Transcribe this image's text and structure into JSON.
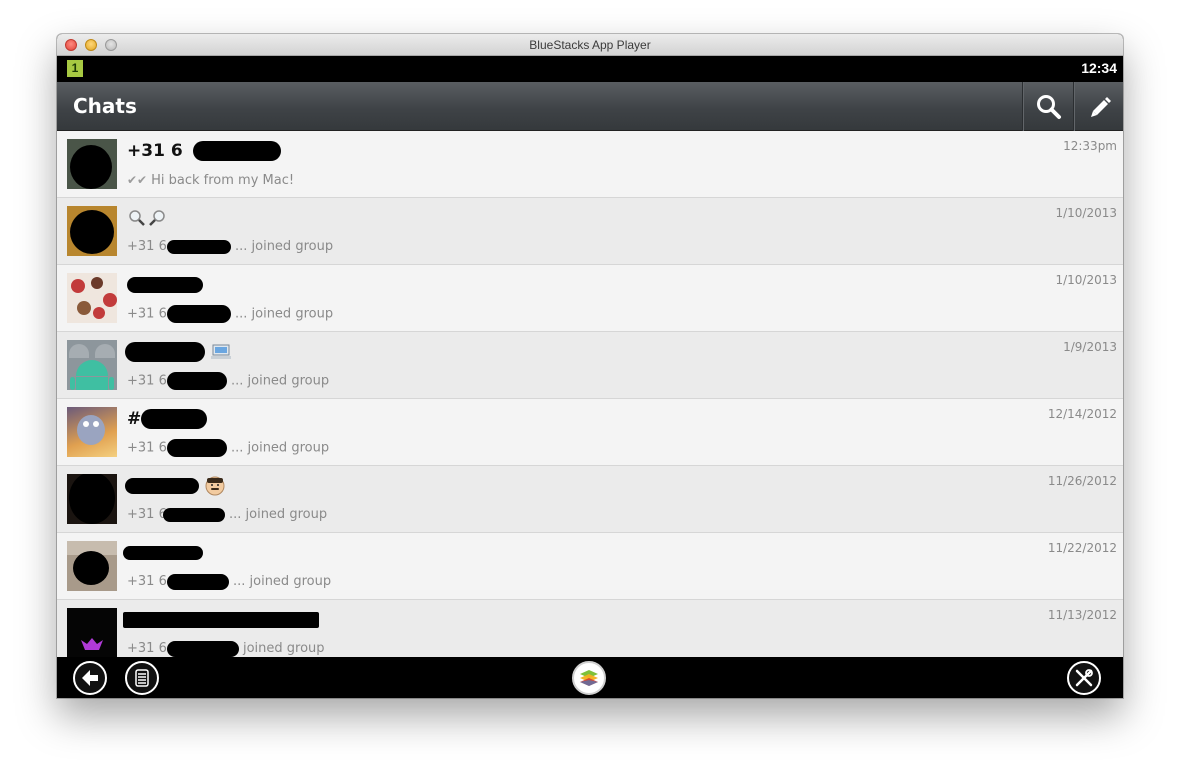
{
  "window": {
    "title": "BlueStacks App Player"
  },
  "statusbar": {
    "notification": "1",
    "time": "12:34"
  },
  "actionbar": {
    "title": "Chats"
  },
  "chats": [
    {
      "name_prefix": "+31 6",
      "message": "Hi back from my Mac!",
      "date": "12:33pm",
      "delivered_icon": "double-check-icon"
    },
    {
      "name_prefix": "",
      "message_prefix": "+31 6",
      "message_suffix": "... joined group",
      "date": "1/10/2013"
    },
    {
      "name_prefix": "",
      "message_prefix": "+31 6",
      "message_suffix": "... joined group",
      "date": "1/10/2013"
    },
    {
      "name_prefix": "",
      "message_prefix": "+31 6",
      "message_suffix": "... joined group",
      "date": "1/9/2013"
    },
    {
      "name_prefix": "#",
      "message_prefix": "+31 6",
      "message_suffix": "... joined group",
      "date": "12/14/2012"
    },
    {
      "name_prefix": "",
      "message_prefix": "+31 6",
      "message_suffix": "... joined group",
      "date": "11/26/2012"
    },
    {
      "name_prefix": "",
      "message_prefix": "+31 6",
      "message_suffix": "... joined group",
      "date": "11/22/2012"
    },
    {
      "name_prefix": "",
      "message_prefix": "+31 6",
      "message_suffix": "joined group",
      "date": "11/13/2012"
    }
  ],
  "icons": {
    "search": "search-icon",
    "compose": "pencil-icon",
    "back": "back-arrow-icon",
    "menu": "menu-icon",
    "home": "bluestacks-home-icon",
    "settings": "tools-icon"
  },
  "colors": {
    "actionbar": "#3f4347",
    "list_bg": "#f2f2f2",
    "navbar": "#000000"
  }
}
